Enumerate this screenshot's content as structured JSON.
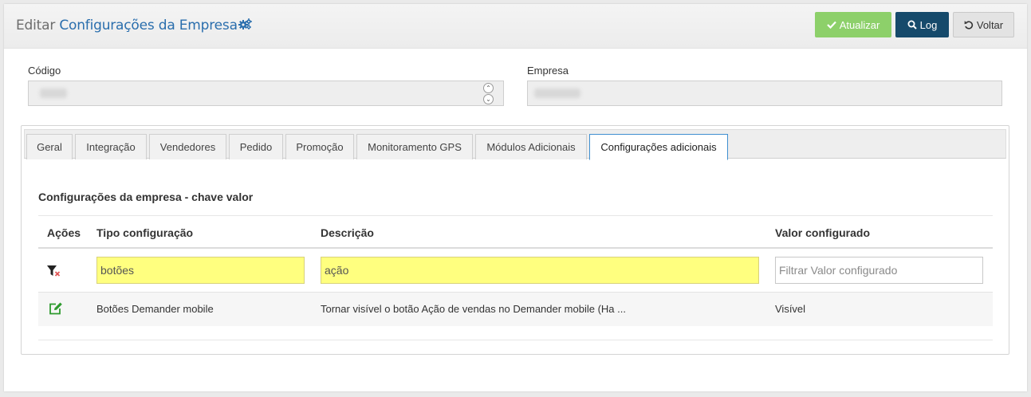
{
  "header": {
    "title_prefix": "Editar ",
    "title_main": "Configurações da Empresa",
    "buttons": {
      "update_label": "Atualizar",
      "log_label": "Log",
      "back_label": "Voltar"
    }
  },
  "form": {
    "codigo_label": "Código",
    "empresa_label": "Empresa"
  },
  "tabs": [
    {
      "label": "Geral"
    },
    {
      "label": "Integração"
    },
    {
      "label": "Vendedores"
    },
    {
      "label": "Pedido"
    },
    {
      "label": "Promoção"
    },
    {
      "label": "Monitoramento GPS"
    },
    {
      "label": "Módulos Adicionais"
    },
    {
      "label": "Configurações adicionais",
      "active": true
    }
  ],
  "section": {
    "title": "Configurações da empresa - chave valor"
  },
  "grid": {
    "columns": [
      "Ações",
      "Tipo configuração",
      "Descrição",
      "Valor configurado"
    ],
    "filters": {
      "tipo_value": "botões",
      "descricao_value": "ação",
      "valor_placeholder": "Filtrar Valor configurado"
    },
    "rows": [
      {
        "tipo": "Botões Demander mobile",
        "descricao": "Tornar visível o botão Ação de vendas no Demander mobile (Ha ...",
        "valor": "Visível"
      }
    ]
  },
  "colors": {
    "accent": "#2a6ead",
    "update_button": "#8dd06a",
    "log_button": "#164a6b",
    "filter_highlight": "#ffff7f",
    "edit_icon": "#2e9a2e"
  }
}
